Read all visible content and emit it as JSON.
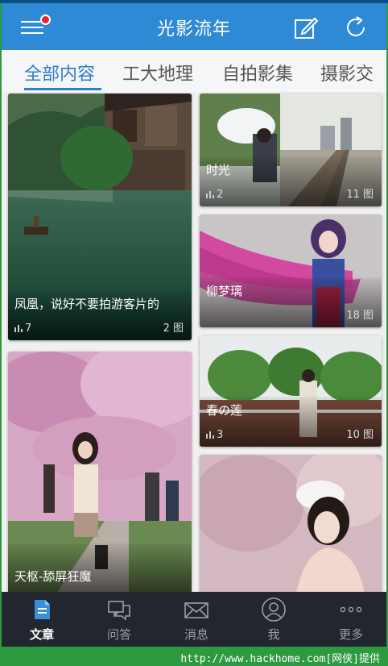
{
  "header": {
    "title": "光影流年",
    "menu_icon": "hamburger-menu-icon",
    "notification_color": "#e8232a",
    "accent": "#2f8ad6"
  },
  "tabs": [
    {
      "label": "全部内容",
      "active": true
    },
    {
      "label": "工大地理",
      "active": false
    },
    {
      "label": "自拍影集",
      "active": false
    },
    {
      "label": "摄影交",
      "active": false
    }
  ],
  "cards": [
    {
      "title": "凤凰，说好不要拍游客片的",
      "likes": "7",
      "pics": "2 图"
    },
    {
      "title": "时光",
      "likes": "2",
      "pics": "11 图"
    },
    {
      "title": "柳梦璃",
      "likes": "",
      "pics": "18 图"
    },
    {
      "title": "春の莲",
      "likes": "3",
      "pics": "10 图"
    },
    {
      "title": "天枢-舔屏狂魔",
      "likes": "",
      "pics": ""
    },
    {
      "title": "",
      "likes": "",
      "pics": ""
    }
  ],
  "nav": [
    {
      "label": "文章",
      "icon": "article-icon",
      "active": true
    },
    {
      "label": "问答",
      "icon": "chat-bubbles-icon",
      "active": false
    },
    {
      "label": "消息",
      "icon": "envelope-icon",
      "active": false
    },
    {
      "label": "我",
      "icon": "user-icon",
      "active": false
    },
    {
      "label": "更多",
      "icon": "more-dots-icon",
      "active": false
    }
  ],
  "footer": {
    "watermark": "http://www.hackhome.com[网侠]提供"
  }
}
